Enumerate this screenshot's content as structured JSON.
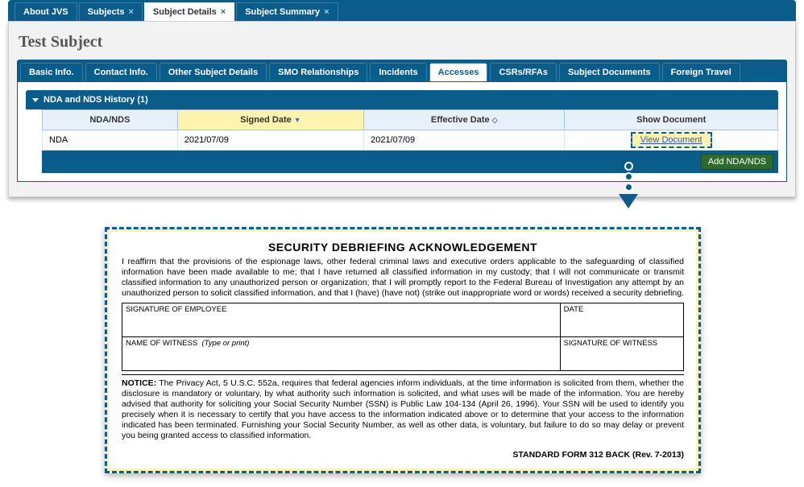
{
  "topTabs": {
    "about": "About JVS",
    "subjects": "Subjects",
    "details": "Subject Details",
    "summary": "Subject Summary"
  },
  "pageTitle": "Test Subject",
  "innerTabs": {
    "basic": "Basic Info.",
    "contact": "Contact Info.",
    "other": "Other Subject Details",
    "smo": "SMO Relationships",
    "incidents": "Incidents",
    "accesses": "Accesses",
    "csrs": "CSRs/RFAs",
    "docs": "Subject Documents",
    "travel": "Foreign Travel"
  },
  "accordion": {
    "title": "NDA and NDS History (1)"
  },
  "table": {
    "headers": {
      "type": "NDA/NDS",
      "signed": "Signed Date",
      "effective": "Effective Date",
      "show": "Show Document"
    },
    "rows": [
      {
        "type": "NDA",
        "signed": "2021/07/09",
        "effective": "2021/07/09",
        "view": "View Document"
      }
    ],
    "addBtn": "Add NDA/NDS"
  },
  "document": {
    "title": "SECURITY DEBRIEFING ACKNOWLEDGEMENT",
    "para": "I reaffirm that the provisions of the espionage laws, other federal criminal laws and executive orders applicable to the safeguarding of classified information have been made available to me; that I have returned all classified information in my custody; that I will not communicate or transmit classified information to any unauthorized person or organization; that I will promptly report to the Federal Bureau of Investigation any attempt by an unauthorized person to solicit classified information, and that I (have) (have not) (strike out inappropriate word or words) received a security debriefing.",
    "sigEmployee": "SIGNATURE OF EMPLOYEE",
    "date": "DATE",
    "witnessName": "NAME OF WITNESS",
    "typeOrPrint": "(Type or print)",
    "sigWitness": "SIGNATURE OF WITNESS",
    "noticeLabel": "NOTICE:",
    "notice": " The Privacy Act, 5 U.S.C. 552a, requires that federal agencies inform individuals, at the time information is solicited from them, whether the disclosure is mandatory or voluntary, by what authority such information is solicited, and what uses will be made of the information. You are hereby advised that authority for soliciting your Social Security Number (SSN) is Public Law 104-134 (April 26, 1996). Your SSN will be used to identify you precisely when it is necessary to certify that you have access to the information indicated above or to determine that your access to the information indicated has been terminated. Furnishing your Social Security Number, as well as other data, is voluntary, but failure to do so may delay or prevent you being granted access to classified information.",
    "footer": "STANDARD FORM 312 BACK (Rev. 7-2013)"
  }
}
